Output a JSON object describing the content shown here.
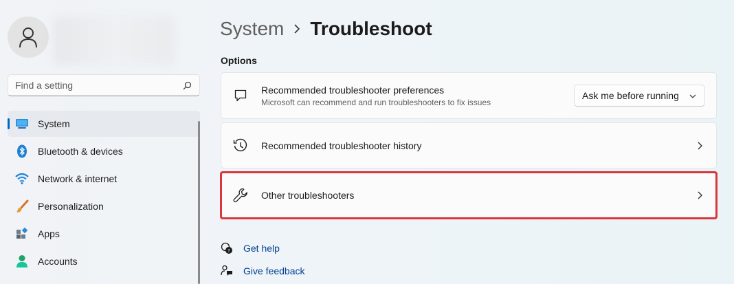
{
  "sidebar": {
    "search": {
      "placeholder": "Find a setting",
      "icon": "search-icon"
    },
    "items": [
      {
        "label": "System",
        "icon": "system-icon",
        "selected": true
      },
      {
        "label": "Bluetooth & devices",
        "icon": "bluetooth-icon"
      },
      {
        "label": "Network & internet",
        "icon": "wifi-icon"
      },
      {
        "label": "Personalization",
        "icon": "brush-icon"
      },
      {
        "label": "Apps",
        "icon": "apps-icon"
      },
      {
        "label": "Accounts",
        "icon": "accounts-icon"
      }
    ]
  },
  "header": {
    "parent": "System",
    "current": "Troubleshoot"
  },
  "options": {
    "label": "Options",
    "preferences": {
      "title": "Recommended troubleshooter preferences",
      "subtitle": "Microsoft can recommend and run troubleshooters to fix issues",
      "dropdown_value": "Ask me before running",
      "icon": "chat-icon"
    },
    "history": {
      "title": "Recommended troubleshooter history",
      "icon": "history-icon"
    },
    "other": {
      "title": "Other troubleshooters",
      "icon": "wrench-icon"
    }
  },
  "links": {
    "help": "Get help",
    "feedback": "Give feedback"
  },
  "colors": {
    "accent": "#0067c0",
    "highlight": "#d9363e",
    "link": "#003e92"
  }
}
